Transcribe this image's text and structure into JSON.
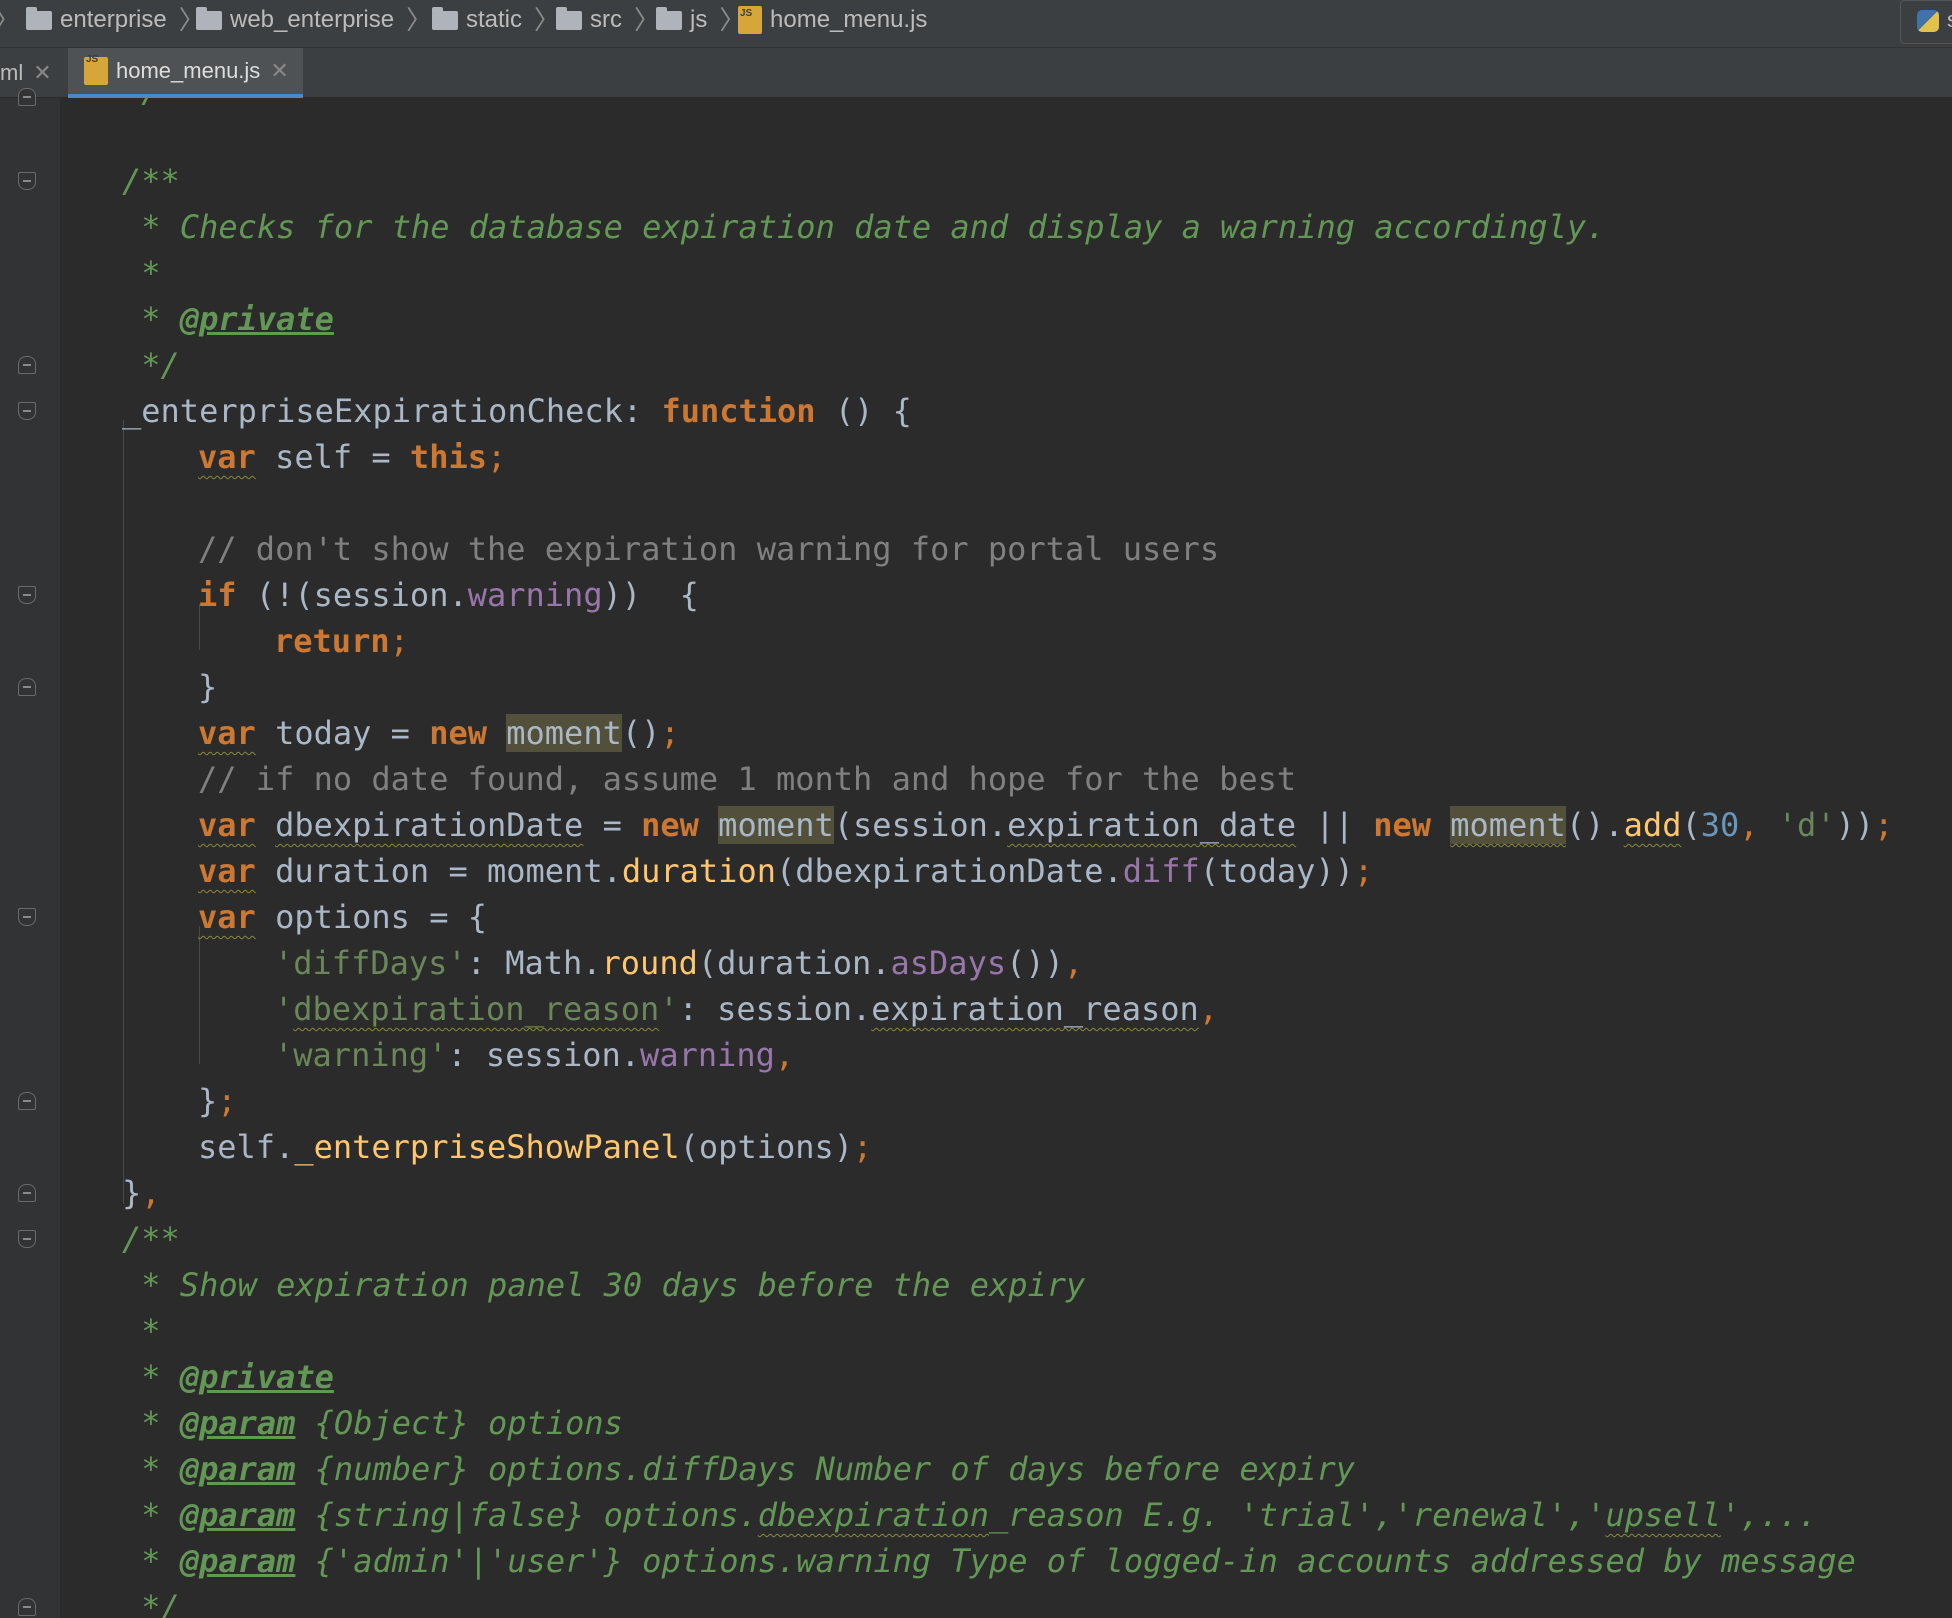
{
  "breadcrumb": [
    "enterprise",
    "web_enterprise",
    "static",
    "src",
    "js",
    "home_menu.js"
  ],
  "tabs": [
    {
      "label": "ml",
      "active": false
    },
    {
      "label": "home_menu.js",
      "active": true
    }
  ],
  "run_label": "s",
  "code": {
    "top_partial": "*/",
    "l1": "/**",
    "l2": " * Checks for the database expiration date and display a warning accordingly.",
    "l3": " *",
    "l4a": " * ",
    "l4b": "@private",
    "l5": " */",
    "l6a": "_enterpriseExpirationCheck: ",
    "l6b": "function",
    "l6c": " () {",
    "l7a": "var",
    "l7b": " self = ",
    "l7c": "this",
    "l7d": ";",
    "l8": "",
    "l9": "// don't show the expiration warning for portal users",
    "l10a": "if",
    "l10b": " (!(session.",
    "l10c": "warning",
    "l10d": "))  {",
    "l11a": "return",
    "l11b": ";",
    "l12": "}",
    "l13a": "var",
    "l13b": " today = ",
    "l13c": "new",
    "l13d": " ",
    "l13e": "moment",
    "l13f": "()",
    "l13g": ";",
    "l14": "// if no date found, assume 1 month and hope for the best",
    "l15a": "var",
    "l15b": " ",
    "l15c": "dbexpirationDate",
    "l15d": " = ",
    "l15e": "new",
    "l15f": " ",
    "l15g": "moment",
    "l15h": "(session.",
    "l15i": "expiration_date",
    "l15j": " || ",
    "l15k": "new",
    "l15l": " ",
    "l15m": "moment",
    "l15n": "().",
    "l15o": "add",
    "l15p": "(",
    "l15q": "30",
    "l15r": ", ",
    "l15s": "'d'",
    "l15t": "))",
    "l15u": ";",
    "l16a": "var",
    "l16b": " duration = moment.",
    "l16c": "duration",
    "l16d": "(dbexpirationDate.",
    "l16e": "diff",
    "l16f": "(today))",
    "l16g": ";",
    "l17a": "var",
    "l17b": " options = {",
    "l18a": "'diffDays'",
    "l18b": ": Math.",
    "l18c": "round",
    "l18d": "(duration.",
    "l18e": "asDays",
    "l18f": "())",
    "l18g": ",",
    "l19a": "'",
    "l19b": "dbexpiration_reason",
    "l19c": "'",
    "l19d": ": session.",
    "l19e": "expiration_reason",
    "l19f": ",",
    "l20a": "'warning'",
    "l20b": ": session.",
    "l20c": "warning",
    "l20d": ",",
    "l21a": "}",
    "l21b": ";",
    "l22a": "self.",
    "l22b": "_enterpriseShowPanel",
    "l22c": "(options)",
    "l22d": ";",
    "l23a": "}",
    "l23b": ",",
    "l24": "/**",
    "l25": " * Show expiration panel 30 days before the expiry",
    "l26": " *",
    "l27a": " * ",
    "l27b": "@private",
    "l28a": " * ",
    "l28b": "@param",
    "l28c": " {Object} options",
    "l29a": " * ",
    "l29b": "@param",
    "l29c": " {number} options.diffDays Number of days before expiry",
    "l30a": " * ",
    "l30b": "@param",
    "l30c": " {string|false} options.",
    "l30d": "dbexpiration",
    "l30e": "_reason E.g. 'trial','renewal','",
    "l30f": "upsell",
    "l30g": "',...",
    "l31a": " * ",
    "l31b": "@param",
    "l31c": " {'admin'|'user'} options.warning Type of logged-in accounts addressed by message",
    "l32": " */"
  }
}
